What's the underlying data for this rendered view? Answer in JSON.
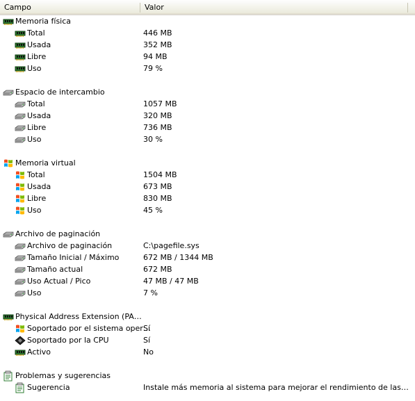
{
  "header": {
    "campo": "Campo",
    "valor": "Valor"
  },
  "groups": [
    {
      "title": "Memoria física",
      "icon": "memory-chip-icon",
      "items": [
        {
          "label": "Total",
          "value": "446 MB",
          "icon": "memory-chip-icon"
        },
        {
          "label": "Usada",
          "value": "352 MB",
          "icon": "memory-chip-icon"
        },
        {
          "label": "Libre",
          "value": "94 MB",
          "icon": "memory-chip-icon"
        },
        {
          "label": "Uso",
          "value": "79 %",
          "icon": "memory-chip-icon"
        }
      ]
    },
    {
      "title": "Espacio de intercambio",
      "icon": "hard-drive-icon",
      "items": [
        {
          "label": "Total",
          "value": "1057 MB",
          "icon": "hard-drive-icon"
        },
        {
          "label": "Usada",
          "value": "320 MB",
          "icon": "hard-drive-icon"
        },
        {
          "label": "Libre",
          "value": "736 MB",
          "icon": "hard-drive-icon"
        },
        {
          "label": "Uso",
          "value": "30 %",
          "icon": "hard-drive-icon"
        }
      ]
    },
    {
      "title": "Memoria virtual",
      "icon": "windows-flag-icon",
      "items": [
        {
          "label": "Total",
          "value": "1504 MB",
          "icon": "windows-flag-icon"
        },
        {
          "label": "Usada",
          "value": "673 MB",
          "icon": "windows-flag-icon"
        },
        {
          "label": "Libre",
          "value": "830 MB",
          "icon": "windows-flag-icon"
        },
        {
          "label": "Uso",
          "value": "45 %",
          "icon": "windows-flag-icon"
        }
      ]
    },
    {
      "title": "Archivo de paginación",
      "icon": "hard-drive-icon",
      "items": [
        {
          "label": "Archivo de paginación",
          "value": "C:\\pagefile.sys",
          "icon": "hard-drive-icon"
        },
        {
          "label": "Tamaño Inicial / Máximo",
          "value": "672 MB / 1344 MB",
          "icon": "hard-drive-icon"
        },
        {
          "label": "Tamaño actual",
          "value": "672 MB",
          "icon": "hard-drive-icon"
        },
        {
          "label": "Uso Actual / Pico",
          "value": "47 MB / 47 MB",
          "icon": "hard-drive-icon"
        },
        {
          "label": "Uso",
          "value": "7 %",
          "icon": "hard-drive-icon"
        }
      ]
    },
    {
      "title": "Physical Address Extension (PAE)",
      "icon": "memory-chip-icon",
      "items": [
        {
          "label": "Soportado por el sistema oper…",
          "value": "Sí",
          "icon": "windows-flag-icon"
        },
        {
          "label": "Soportado por la CPU",
          "value": "Sí",
          "icon": "cpu-chip-icon"
        },
        {
          "label": "Activo",
          "value": "No",
          "icon": "memory-chip-icon"
        }
      ]
    },
    {
      "title": "Problemas y sugerencias",
      "icon": "suggestion-note-icon",
      "items": [
        {
          "label": "Sugerencia",
          "value": "Instale más memoria al sistema para mejorar el rendimiento de las aplicacion…",
          "icon": "suggestion-note-icon"
        }
      ]
    }
  ]
}
